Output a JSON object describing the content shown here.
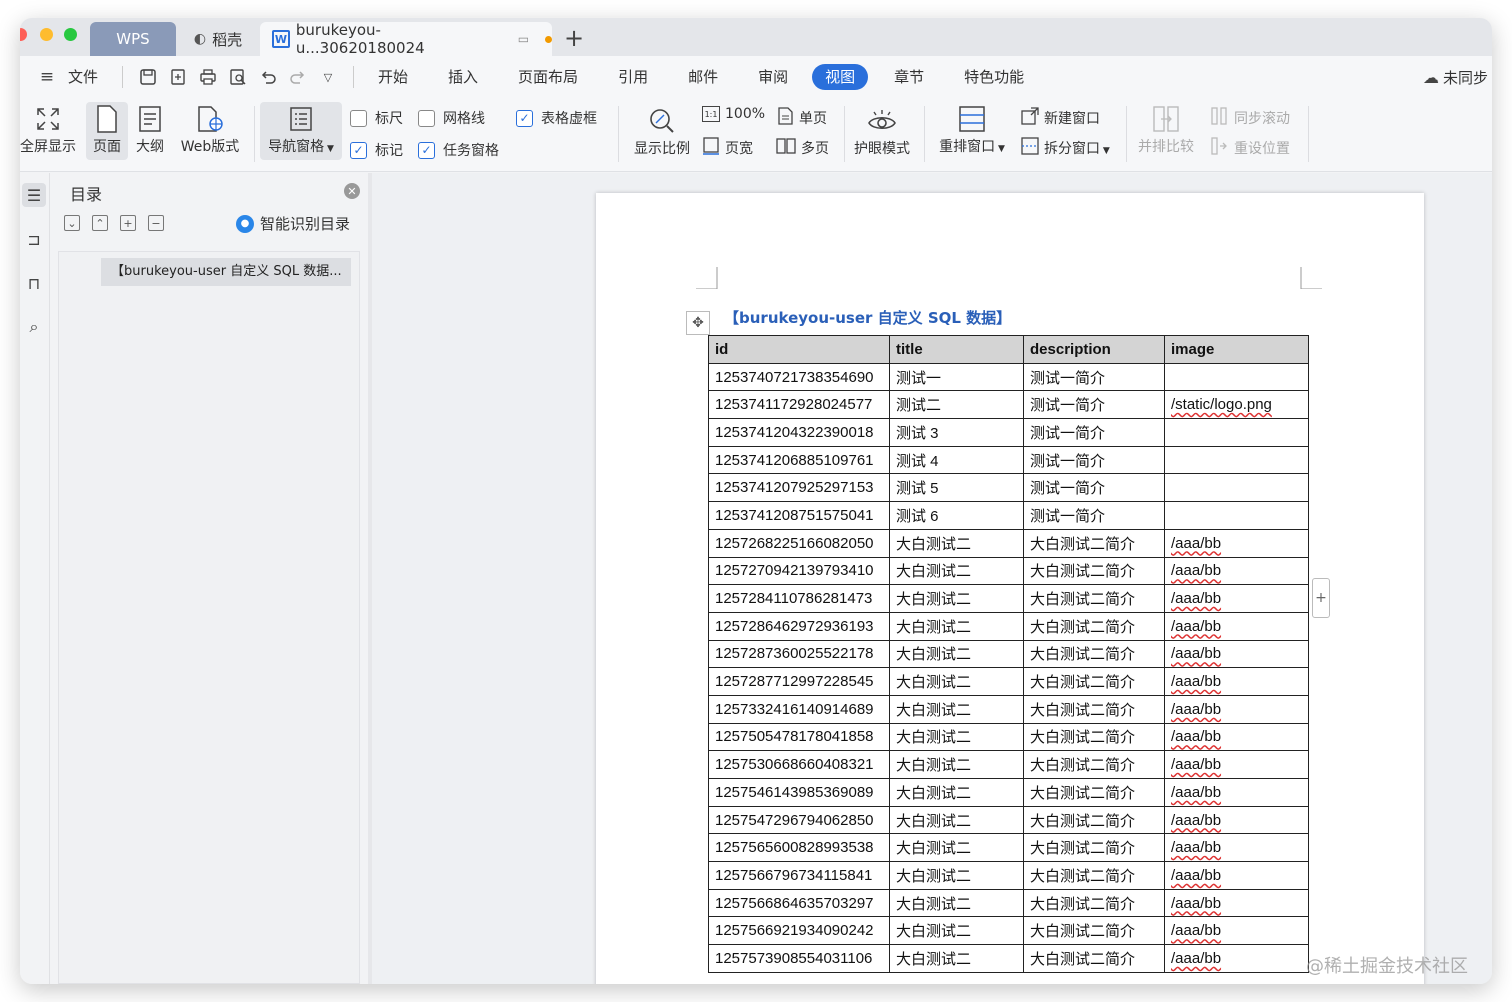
{
  "tabs": {
    "wps": "WPS",
    "daoke": "稻壳",
    "doc": "burukeyou-u...30620180024"
  },
  "menu": {
    "hamburger": "≡",
    "file": "文件",
    "items": [
      "开始",
      "插入",
      "页面布局",
      "引用",
      "邮件",
      "审阅",
      "视图",
      "章节",
      "特色功能"
    ],
    "sync": "未同步"
  },
  "ribbon": {
    "fullscreen": "全屏显示",
    "page": "页面",
    "outline": "大纲",
    "web": "Web版式",
    "nav_pane": "导航窗格",
    "ruler": "标尺",
    "gridlines": "网格线",
    "table_gridlines": "表格虚框",
    "marks": "标记",
    "task_pane": "任务窗格",
    "zoom": "显示比例",
    "hundred": "100%",
    "page_width": "页宽",
    "single_page": "单页",
    "multi_page": "多页",
    "eye_mode": "护眼模式",
    "arrange": "重排窗口",
    "new_window": "新建窗口",
    "split_window": "拆分窗口",
    "compare": "并排比较",
    "sync_scroll": "同步滚动",
    "reset_pos": "重设位置"
  },
  "nav": {
    "title": "目录",
    "smart_toc": "智能识别目录",
    "entry": "【burukeyou-user 自定义 SQL 数据..."
  },
  "doc": {
    "heading": "【burukeyou-user 自定义 SQL 数据】",
    "columns": [
      "id",
      "title",
      "description",
      "image"
    ],
    "rows": [
      [
        "1253740721738354690",
        "测试一",
        "测试一简介",
        ""
      ],
      [
        "1253741172928024577",
        "测试二",
        "测试一简介",
        "/static/logo.png"
      ],
      [
        "1253741204322390018",
        "测试 3",
        "测试一简介",
        ""
      ],
      [
        "1253741206885109761",
        "测试 4",
        "测试一简介",
        ""
      ],
      [
        "1253741207925297153",
        "测试 5",
        "测试一简介",
        ""
      ],
      [
        "1253741208751575041",
        "测试 6",
        "测试一简介",
        ""
      ],
      [
        "1257268225166082050",
        "大白测试二",
        "大白测试二简介",
        "/aaa/bb"
      ],
      [
        "1257270942139793410",
        "大白测试二",
        "大白测试二简介",
        "/aaa/bb"
      ],
      [
        "1257284110786281473",
        "大白测试二",
        "大白测试二简介",
        "/aaa/bb"
      ],
      [
        "1257286462972936193",
        "大白测试二",
        "大白测试二简介",
        "/aaa/bb"
      ],
      [
        "1257287360025522178",
        "大白测试二",
        "大白测试二简介",
        "/aaa/bb"
      ],
      [
        "1257287712997228545",
        "大白测试二",
        "大白测试二简介",
        "/aaa/bb"
      ],
      [
        "1257332416140914689",
        "大白测试二",
        "大白测试二简介",
        "/aaa/bb"
      ],
      [
        "1257505478178041858",
        "大白测试二",
        "大白测试二简介",
        "/aaa/bb"
      ],
      [
        "1257530668660408321",
        "大白测试二",
        "大白测试二简介",
        "/aaa/bb"
      ],
      [
        "1257546143985369089",
        "大白测试二",
        "大白测试二简介",
        "/aaa/bb"
      ],
      [
        "1257547296794062850",
        "大白测试二",
        "大白测试二简介",
        "/aaa/bb"
      ],
      [
        "1257565600828993538",
        "大白测试二",
        "大白测试二简介",
        "/aaa/bb"
      ],
      [
        "1257566796734115841",
        "大白测试二",
        "大白测试二简介",
        "/aaa/bb"
      ],
      [
        "1257566864635703297",
        "大白测试二",
        "大白测试二简介",
        "/aaa/bb"
      ],
      [
        "1257566921934090242",
        "大白测试二",
        "大白测试二简介",
        "/aaa/bb"
      ],
      [
        "1257573908554031106",
        "大白测试二",
        "大白测试二简介",
        "/aaa/bb"
      ]
    ]
  },
  "watermark": "@稀土掘金技术社区",
  "colors": {
    "accent": "#2a6fdb",
    "heading": "#2a5fb8",
    "table_header_bg": "#d4d4d4",
    "tab_wps": "#8a9ab8"
  }
}
